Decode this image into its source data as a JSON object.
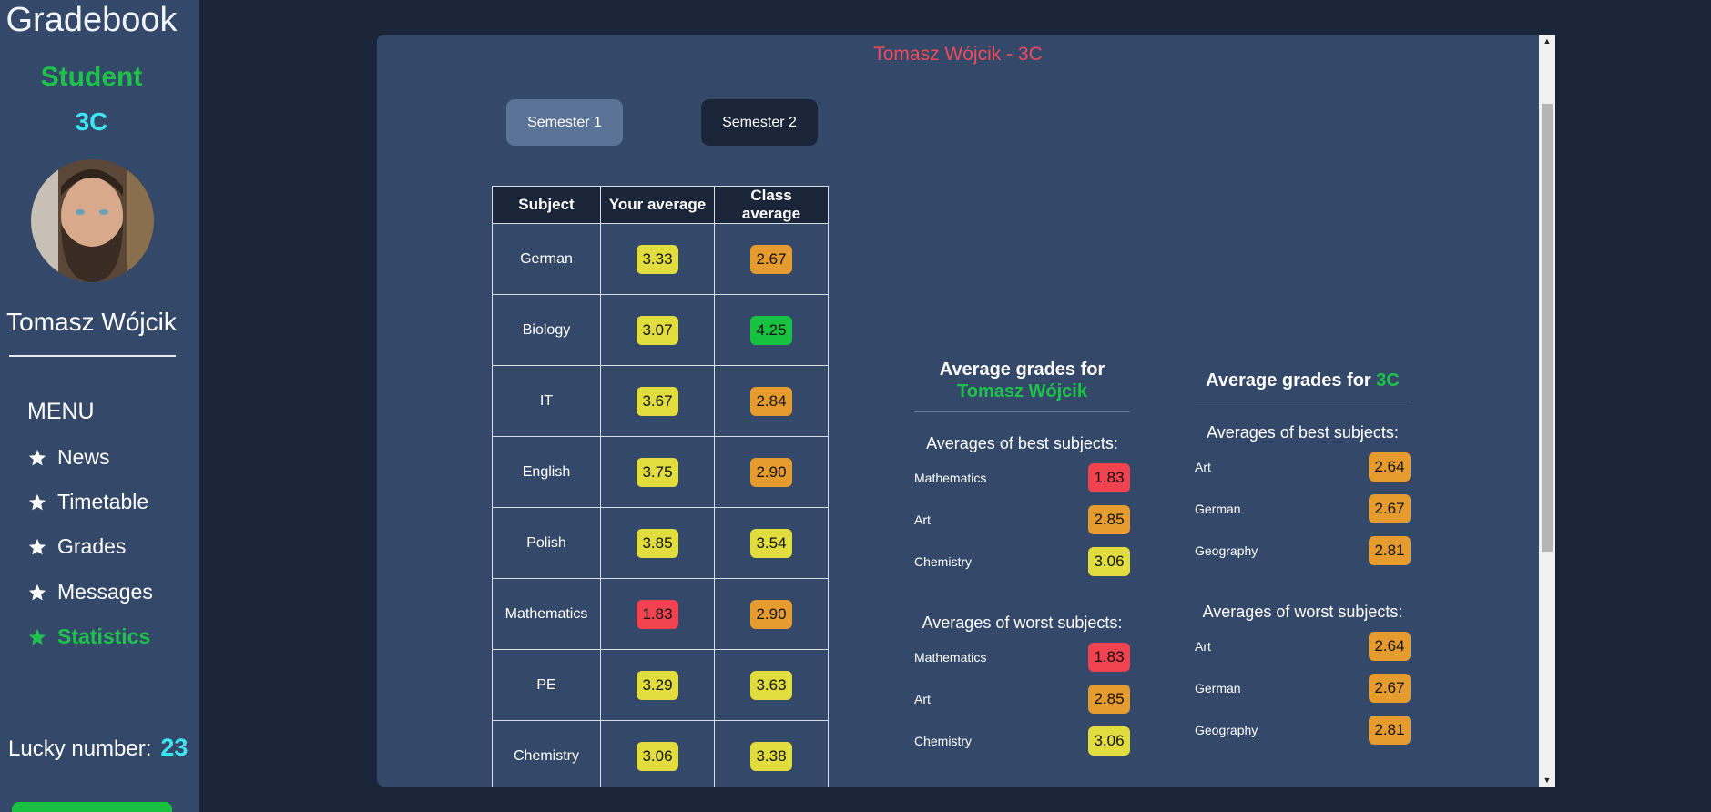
{
  "sidebar": {
    "app_title": "Gradebook",
    "role": "Student",
    "class": "3C",
    "user_name": "Tomasz Wójcik",
    "menu_title": "MENU",
    "menu": [
      {
        "label": "News",
        "active": false
      },
      {
        "label": "Timetable",
        "active": false
      },
      {
        "label": "Grades",
        "active": false
      },
      {
        "label": "Messages",
        "active": false
      },
      {
        "label": "Statistics",
        "active": true
      }
    ],
    "lucky_label": "Lucky number:",
    "lucky_number": "23"
  },
  "main": {
    "title": "Tomasz Wójcik - 3C",
    "semester_buttons": [
      "Semester 1",
      "Semester 2"
    ],
    "table": {
      "headers": [
        "Subject",
        "Your average",
        "Class average"
      ],
      "rows": [
        {
          "subject": "German",
          "yours": "3.33",
          "yours_color": "#e2dd3e",
          "class": "2.67",
          "class_color": "#e69b2e"
        },
        {
          "subject": "Biology",
          "yours": "3.07",
          "yours_color": "#e2dd3e",
          "class": "4.25",
          "class_color": "#16c23f"
        },
        {
          "subject": "IT",
          "yours": "3.67",
          "yours_color": "#e2dd3e",
          "class": "2.84",
          "class_color": "#e69b2e"
        },
        {
          "subject": "English",
          "yours": "3.75",
          "yours_color": "#e2dd3e",
          "class": "2.90",
          "class_color": "#e69b2e"
        },
        {
          "subject": "Polish",
          "yours": "3.85",
          "yours_color": "#e2dd3e",
          "class": "3.54",
          "class_color": "#e2dd3e"
        },
        {
          "subject": "Mathematics",
          "yours": "1.83",
          "yours_color": "#f0434f",
          "class": "2.90",
          "class_color": "#e69b2e"
        },
        {
          "subject": "PE",
          "yours": "3.29",
          "yours_color": "#e2dd3e",
          "class": "3.63",
          "class_color": "#e2dd3e"
        },
        {
          "subject": "Chemistry",
          "yours": "3.06",
          "yours_color": "#e2dd3e",
          "class": "3.38",
          "class_color": "#e2dd3e"
        }
      ]
    },
    "student_stats": {
      "heading_prefix": "Average grades for",
      "heading_name": "Tomasz Wójcik",
      "best_label": "Averages of best subjects:",
      "best": [
        {
          "subject": "Mathematics",
          "value": "1.83",
          "color": "#f0434f"
        },
        {
          "subject": "Art",
          "value": "2.85",
          "color": "#e69b2e"
        },
        {
          "subject": "Chemistry",
          "value": "3.06",
          "color": "#e2dd3e"
        }
      ],
      "worst_label": "Averages of worst subjects:",
      "worst": [
        {
          "subject": "Mathematics",
          "value": "1.83",
          "color": "#f0434f"
        },
        {
          "subject": "Art",
          "value": "2.85",
          "color": "#e69b2e"
        },
        {
          "subject": "Chemistry",
          "value": "3.06",
          "color": "#e2dd3e"
        }
      ]
    },
    "class_stats": {
      "heading_prefix": "Average grades for",
      "heading_name": "3C",
      "best_label": "Averages of best subjects:",
      "best": [
        {
          "subject": "Art",
          "value": "2.64",
          "color": "#e69b2e"
        },
        {
          "subject": "German",
          "value": "2.67",
          "color": "#e69b2e"
        },
        {
          "subject": "Geography",
          "value": "2.81",
          "color": "#e69b2e"
        }
      ],
      "worst_label": "Averages of worst subjects:",
      "worst": [
        {
          "subject": "Art",
          "value": "2.64",
          "color": "#e69b2e"
        },
        {
          "subject": "German",
          "value": "2.67",
          "color": "#e69b2e"
        },
        {
          "subject": "Geography",
          "value": "2.81",
          "color": "#e69b2e"
        }
      ]
    }
  }
}
